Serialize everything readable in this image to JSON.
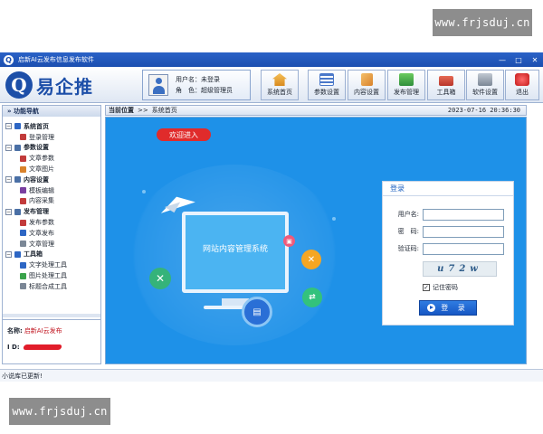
{
  "watermark_top": "www.frjsduj.cn",
  "watermark_bottom": "www.frjsduj.cn",
  "window": {
    "title": "启新AI云发布信息发布软件",
    "controls": [
      "—",
      "□",
      "✕"
    ]
  },
  "logo": {
    "mark": "Q",
    "text": "易企推"
  },
  "user": {
    "name_label": "用户名：",
    "name_value": "未登录",
    "role_label": "角　色：",
    "role_value": "超级管理员"
  },
  "toolbar": [
    {
      "label": "系统首页",
      "icon": "home-icon",
      "color": "#e0a23a"
    },
    {
      "label": "参数设置",
      "icon": "list-icon",
      "color": "#4a78c9"
    },
    {
      "label": "内容设置",
      "icon": "document-icon",
      "color": "#d9822b"
    },
    {
      "label": "发布管理",
      "icon": "publish-icon",
      "color": "#3aa34b"
    },
    {
      "label": "工具箱",
      "icon": "toolbox-icon",
      "color": "#c84a3a"
    },
    {
      "label": "软件设置",
      "icon": "printer-icon",
      "color": "#7b8796"
    },
    {
      "label": "退出",
      "icon": "power-icon",
      "color": "#d92424"
    }
  ],
  "nav": {
    "title": "» 功能导航",
    "tree": [
      {
        "label": "系统首页",
        "type": "parent",
        "icon": "home-icon",
        "color": "#2d66c4"
      },
      {
        "label": "登录管理",
        "type": "child",
        "icon": "user-icon",
        "color": "#c23b3b"
      },
      {
        "label": "参数设置",
        "type": "parent",
        "icon": "settings-icon",
        "color": "#4a6fa5"
      },
      {
        "label": "文章参数",
        "type": "child",
        "icon": "gear-icon",
        "color": "#c23b3b"
      },
      {
        "label": "文章图片",
        "type": "child",
        "icon": "image-icon",
        "color": "#d9822b"
      },
      {
        "label": "内容设置",
        "type": "parent",
        "icon": "content-icon",
        "color": "#4a6fa5"
      },
      {
        "label": "模板编辑",
        "type": "child",
        "icon": "template-icon",
        "color": "#7a3fa0"
      },
      {
        "label": "内容采集",
        "type": "child",
        "icon": "collect-icon",
        "color": "#c23b3b"
      },
      {
        "label": "发布管理",
        "type": "parent",
        "icon": "monitor-icon",
        "color": "#4a6fa5"
      },
      {
        "label": "发布参数",
        "type": "child",
        "icon": "clock-icon",
        "color": "#c23b3b"
      },
      {
        "label": "文章发布",
        "type": "child",
        "icon": "gear-icon",
        "color": "#2d66c4"
      },
      {
        "label": "文章管理",
        "type": "child",
        "icon": "grid-icon",
        "color": "#7b8796"
      },
      {
        "label": "工具箱",
        "type": "parent",
        "icon": "toolbox-icon",
        "color": "#2d66c4"
      },
      {
        "label": "文字处理工具",
        "type": "child",
        "icon": "text-icon",
        "color": "#2d66c4"
      },
      {
        "label": "图片处理工具",
        "type": "child",
        "icon": "picture-icon",
        "color": "#3aa34b"
      },
      {
        "label": "标题合成工具",
        "type": "child",
        "icon": "title-icon",
        "color": "#7b8796"
      }
    ]
  },
  "info": {
    "name_label": "名称:",
    "name_value": "启新AI云发布",
    "id_label": "I  D:"
  },
  "breadcrumb": {
    "label": "当前位置",
    "sep": ">>",
    "current": "系统首页",
    "datetime": "2023-07-16 20:36:30"
  },
  "hero": {
    "welcome": "欢迎进入",
    "monitor_text": "网站内容管理系统"
  },
  "login": {
    "title": "登录",
    "user_label": "用户名:",
    "user_value": "",
    "pwd_label": "密　码:",
    "captcha_label": "验证码:",
    "captcha_text": "u72w",
    "remember_label": "记住密码",
    "remember_checked": "✓",
    "button_label": "登 录"
  },
  "status": "小说库已更新!"
}
